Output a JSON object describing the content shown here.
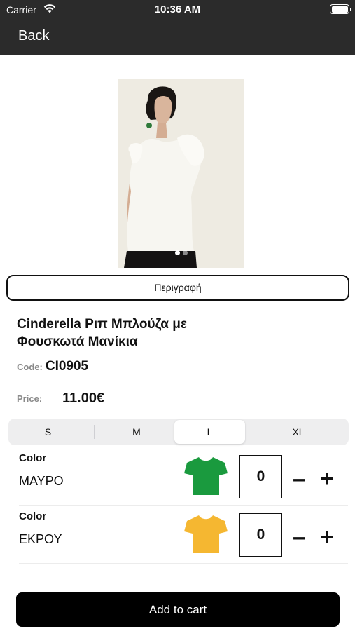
{
  "status_bar": {
    "carrier": "Carrier",
    "time": "10:36 AM"
  },
  "nav": {
    "back_label": "Back"
  },
  "gallery": {
    "page_count": 2,
    "active_index": 0
  },
  "description_button": {
    "label": "Περιγραφή"
  },
  "product": {
    "title": "Cinderella Ριπ Μπλούζα με Φουσκωτά Μανίκια",
    "code_label": "Code:",
    "code": "CI0905",
    "price_label": "Price:",
    "price": "11.00€"
  },
  "sizes": {
    "options": [
      "S",
      "M",
      "L",
      "XL"
    ],
    "selected": "L"
  },
  "colors": [
    {
      "label": "Color",
      "name": "ΜΑΥΡΟ",
      "swatch": "#1a9a3e",
      "quantity": "0",
      "minus": "–",
      "plus": "+"
    },
    {
      "label": "Color",
      "name": "ΕΚΡΟΥ",
      "swatch": "#f5b731",
      "quantity": "0",
      "minus": "–",
      "plus": "+"
    }
  ],
  "cart": {
    "button_label": "Add to cart"
  }
}
